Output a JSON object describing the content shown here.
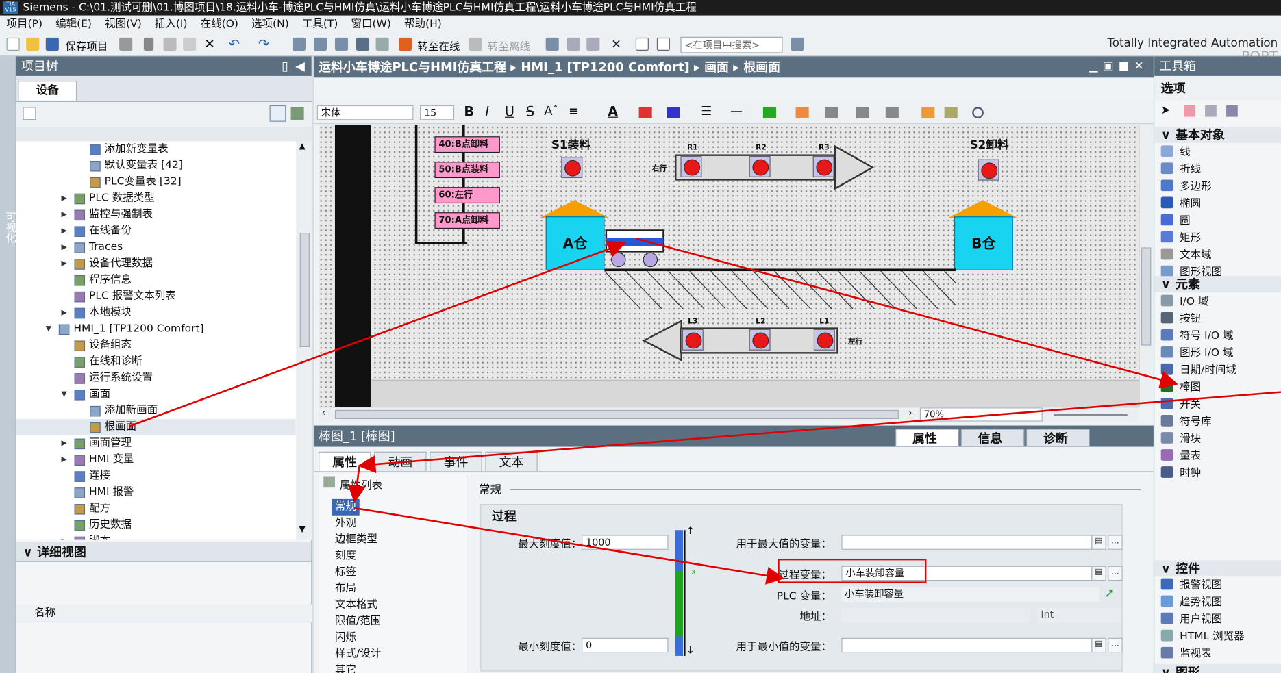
{
  "window": {
    "title": "Siemens  -  C:\\01.测试可删\\01.博图项目\\18.运料小车-博途PLC与HMI仿真\\运料小车博途PLC与HMI仿真工程\\运料小车博途PLC与HMI仿真工程"
  },
  "menu": [
    "项目(P)",
    "编辑(E)",
    "视图(V)",
    "插入(I)",
    "在线(O)",
    "选项(N)",
    "工具(T)",
    "窗口(W)",
    "帮助(H)"
  ],
  "toolbar": {
    "save": "保存项目",
    "go_online": "转至在线",
    "go_offline": "转至离线",
    "search_placeholder": "<在项目中搜索>"
  },
  "brand": {
    "line1": "Totally Integrated Automation",
    "line2": "PORT"
  },
  "side_strip": "可视化",
  "project_tree": {
    "title": "项目树",
    "tab": "设备",
    "items": [
      {
        "label": "添加新变量表",
        "indent": 4
      },
      {
        "label": "默认变量表 [42]",
        "indent": 4
      },
      {
        "label": "PLC变量表 [32]",
        "indent": 4
      },
      {
        "label": "PLC 数据类型",
        "indent": 3,
        "arrow": "▶"
      },
      {
        "label": "监控与强制表",
        "indent": 3,
        "arrow": "▶"
      },
      {
        "label": "在线备份",
        "indent": 3,
        "arrow": "▶"
      },
      {
        "label": "Traces",
        "indent": 3,
        "arrow": "▶"
      },
      {
        "label": "设备代理数据",
        "indent": 3,
        "arrow": "▶"
      },
      {
        "label": "程序信息",
        "indent": 3
      },
      {
        "label": "PLC 报警文本列表",
        "indent": 3
      },
      {
        "label": "本地模块",
        "indent": 3,
        "arrow": "▶"
      },
      {
        "label": "HMI_1 [TP1200 Comfort]",
        "indent": 2,
        "arrow": "▼"
      },
      {
        "label": "设备组态",
        "indent": 3
      },
      {
        "label": "在线和诊断",
        "indent": 3
      },
      {
        "label": "运行系统设置",
        "indent": 3
      },
      {
        "label": "画面",
        "indent": 3,
        "arrow": "▼"
      },
      {
        "label": "添加新画面",
        "indent": 4
      },
      {
        "label": "根画面",
        "indent": 4
      },
      {
        "label": "画面管理",
        "indent": 3,
        "arrow": "▶"
      },
      {
        "label": "HMI 变量",
        "indent": 3,
        "arrow": "▶"
      },
      {
        "label": "连接",
        "indent": 3
      },
      {
        "label": "HMI 报警",
        "indent": 3
      },
      {
        "label": "配方",
        "indent": 3
      },
      {
        "label": "历史数据",
        "indent": 3
      },
      {
        "label": "脚本",
        "indent": 3,
        "arrow": "▶"
      }
    ]
  },
  "detail_view": {
    "title": "详细视图",
    "col_name": "名称"
  },
  "editor": {
    "breadcrumb": [
      "运料小车博途PLC与HMI仿真工程",
      "HMI_1 [TP1200 Comfort]",
      "画面",
      "根画面"
    ],
    "font": "宋体",
    "font_size": "15",
    "zoom": "70%"
  },
  "screen": {
    "commands": [
      "40:B点卸料",
      "50:B点装料",
      "60:左行",
      "70:A点卸料"
    ],
    "s1": "S1装料",
    "s2": "S2卸料",
    "right_labels": [
      "R1",
      "R2",
      "R3"
    ],
    "right_text": "右行",
    "left_labels": [
      "L3",
      "L2",
      "L1"
    ],
    "left_text": "左行",
    "warehouse_a": "A仓",
    "warehouse_b": "B仓"
  },
  "properties": {
    "object": "棒图_1 [棒图]",
    "right_tabs": [
      "属性",
      "信息",
      "诊断"
    ],
    "tabs": [
      "属性",
      "动画",
      "事件",
      "文本"
    ],
    "list_title": "属性列表",
    "categories": [
      "常规",
      "外观",
      "边框类型",
      "刻度",
      "标签",
      "布局",
      "文本格式",
      "限值/范围",
      "闪烁",
      "样式/设计",
      "其它"
    ],
    "section": "常规",
    "group": "过程",
    "max_label": "最大刻度值：",
    "max_value": "1000",
    "min_label": "最小刻度值：",
    "min_value": "0",
    "max_var_label": "用于最大值的变量：",
    "process_var_label": "过程变量：",
    "process_var": "小车装卸容量",
    "plc_var_label": "PLC 变量：",
    "plc_var": "小车装卸容量",
    "addr_label": "地址：",
    "addr_type": "Int",
    "min_var_label": "用于最小值的变量："
  },
  "toolbox": {
    "title": "工具箱",
    "options": "选项",
    "basic_title": "基本对象",
    "basic": [
      "线",
      "折线",
      "多边形",
      "椭圆",
      "圆",
      "矩形",
      "文本域",
      "图形视图"
    ],
    "elements_title": "元素",
    "elements": [
      "I/O 域",
      "按钮",
      "符号 I/O 域",
      "图形 I/O 域",
      "日期/时间域",
      "棒图",
      "开关",
      "符号库",
      "滑块",
      "量表",
      "时钟"
    ],
    "controls_title": "控件",
    "controls": [
      "报警视图",
      "趋势视图",
      "用户视图",
      "HTML 浏览器",
      "监视表"
    ],
    "graphics_title": "图形"
  },
  "colors": {
    "panel_header": "#5c6f80",
    "annotation": "#e00000",
    "bar_fill": "#22a022",
    "bar_scale": "#3a6fd8",
    "lamp": "#e81818",
    "warehouse": "#19d4f0",
    "roof": "#f5a000"
  }
}
